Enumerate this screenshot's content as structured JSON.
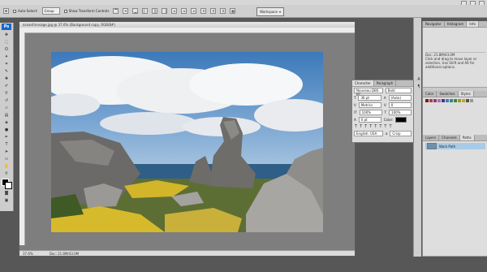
{
  "options_bar": {
    "auto_select_label": "Auto-Select:",
    "auto_select_value": "Group",
    "show_transform_label": "Show Transform Controls",
    "workspace_label": "Workspace"
  },
  "document": {
    "title": "oceanfronsage.jpg @ 37.6% (Background copy, RGB/8#)",
    "zoom": "37.6%",
    "doc_size": "Doc: 21.8M/43.0M"
  },
  "navigator": {
    "tabs": [
      "Navigator",
      "Histogram",
      "Info"
    ],
    "active_tab": "Info",
    "doc_line": "Doc: 21.8M/43.0M",
    "hint": "Click and drag to move layer or selection. Use Shift and Alt for additional options."
  },
  "color_panel": {
    "tabs": [
      "Color",
      "Swatches",
      "Styles"
    ],
    "active_tab": "Styles"
  },
  "layers_panel": {
    "tabs": [
      "Layers",
      "Channels",
      "Paths"
    ],
    "active_tab": "Paths",
    "item": "Work Path"
  },
  "character_panel": {
    "tabs": [
      "Character",
      "Paragraph"
    ],
    "font_family": "Nouveau DBS BT",
    "font_style": "Bold",
    "font_size": "36 pt",
    "leading": "(Auto)",
    "kerning": "Metrics",
    "tracking": "0",
    "vertical_scale": "100%",
    "horizontal_scale": "100%",
    "baseline": "0 pt",
    "color_label": "Color:",
    "language": "English: USA",
    "antialias": "Crisp"
  },
  "colors": {
    "accent": "#1b67c6",
    "panel_bg": "#dedede",
    "workspace_bg": "#575757"
  }
}
